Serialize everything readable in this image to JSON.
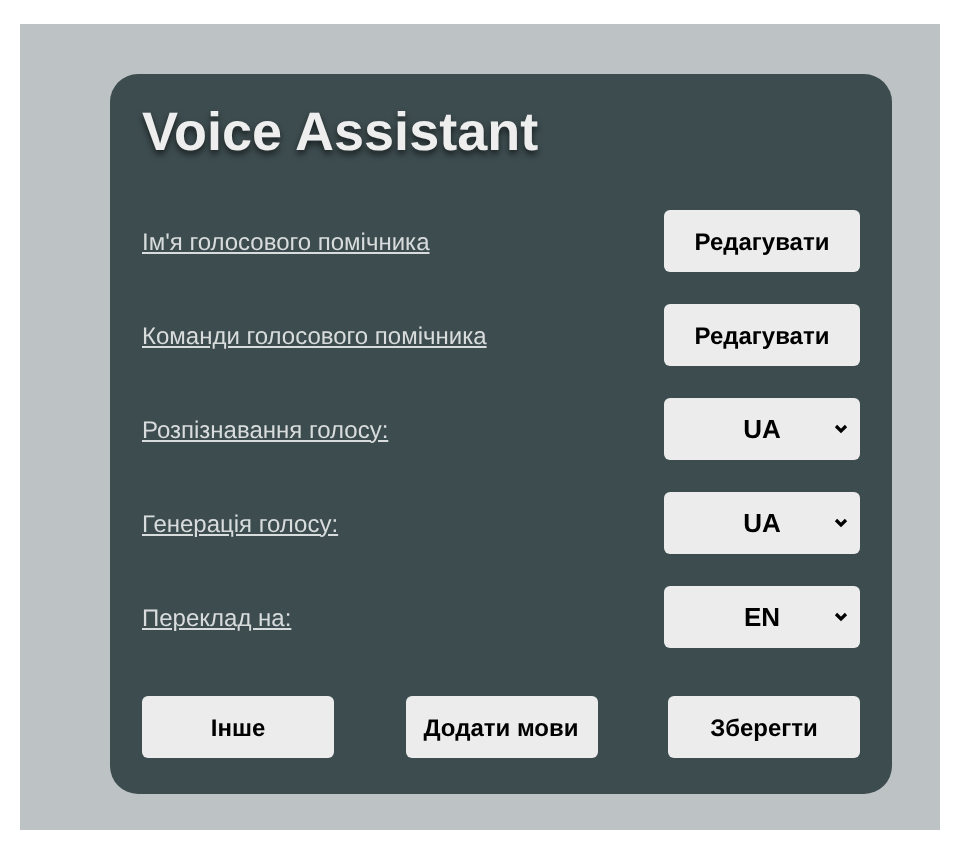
{
  "title": "Voice Assistant",
  "settings": [
    {
      "kind": "button",
      "label": "Ім'я голосового помічника",
      "action": "Редагувати"
    },
    {
      "kind": "button",
      "label": "Команди голосового помічника",
      "action": "Редагувати"
    },
    {
      "kind": "select",
      "label": "Розпізнавання голосу:",
      "value": "UA"
    },
    {
      "kind": "select",
      "label": "Генерація голосу:",
      "value": "UA"
    },
    {
      "kind": "select",
      "label": "Переклад на:",
      "value": "EN"
    }
  ],
  "buttons": [
    "Інше",
    "Додати мови",
    "Зберегти"
  ]
}
